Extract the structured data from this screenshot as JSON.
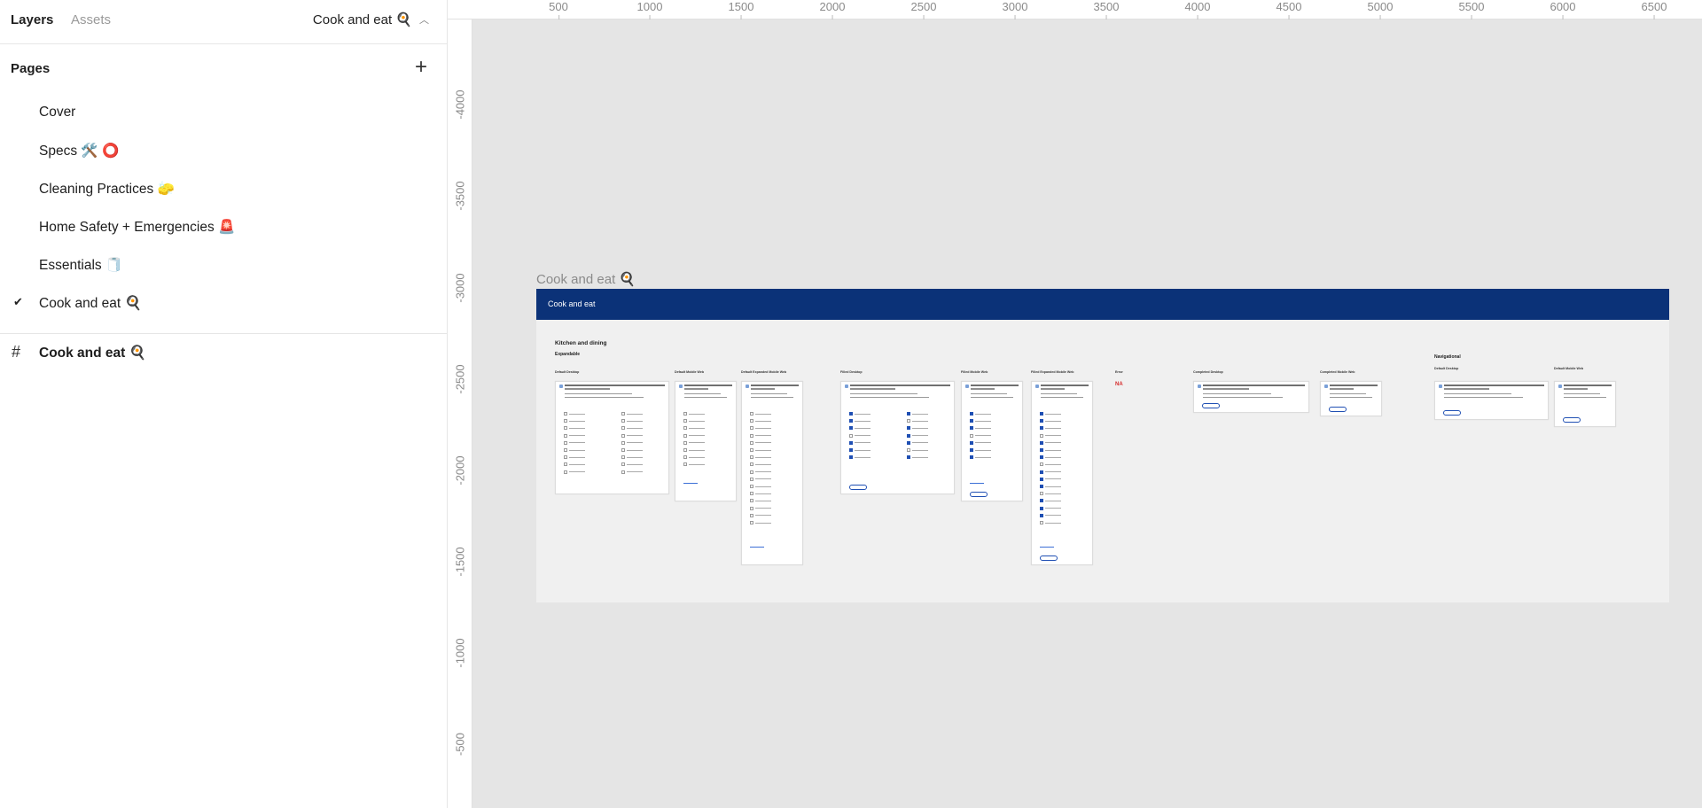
{
  "left_panel": {
    "tabs": {
      "layers": "Layers",
      "assets": "Assets"
    },
    "current_page": "Cook and eat 🍳",
    "pages_label": "Pages",
    "add_page_symbol": "+",
    "pages": [
      {
        "name": "Cover",
        "selected": false
      },
      {
        "name": "Specs 🛠️ ⭕",
        "selected": false
      },
      {
        "name": "Cleaning Practices 🧽",
        "selected": false
      },
      {
        "name": "Home Safety + Emergencies 🚨",
        "selected": false
      },
      {
        "name": "Essentials 🧻",
        "selected": false
      },
      {
        "name": "Cook and eat 🍳",
        "selected": true
      }
    ],
    "check_symbol": "✔",
    "layers": [
      {
        "name": "Cook and eat 🍳",
        "icon": "frame-hash-icon",
        "symbol": "#"
      }
    ]
  },
  "ruler": {
    "top_ticks": [
      "500",
      "1000",
      "1500",
      "2000",
      "2500",
      "3000",
      "3500",
      "4000",
      "4500",
      "5000",
      "5500",
      "6000",
      "6500"
    ],
    "left_ticks": [
      "-4000",
      "-3500",
      "-3000",
      "-2500",
      "-2000",
      "-1500",
      "-1000",
      "-500"
    ]
  },
  "canvas": {
    "frame_label": "Cook and eat 🍳",
    "frame_header": "Cook and eat",
    "section_title": "Kitchen and dining",
    "section_subtitle": "Expandable",
    "navigational_label": "Navigational",
    "error_value": "NA",
    "column_labels": [
      "Default Desktop",
      "Default Mobile Web",
      "Default Expanded Mobile Web",
      "Filled Desktop",
      "Filled Mobile Web",
      "Filled Expanded Mobile Web",
      "Error",
      "Completed Desktop",
      "Completed Mobile Web",
      "Default Desktop",
      "Default Mobile Web"
    ]
  },
  "colors": {
    "frame_header_bg": "#0b3278",
    "checkbox_checked": "#1f4fb3",
    "error_text": "#d62b2b",
    "canvas_bg": "#e5e5e5"
  }
}
